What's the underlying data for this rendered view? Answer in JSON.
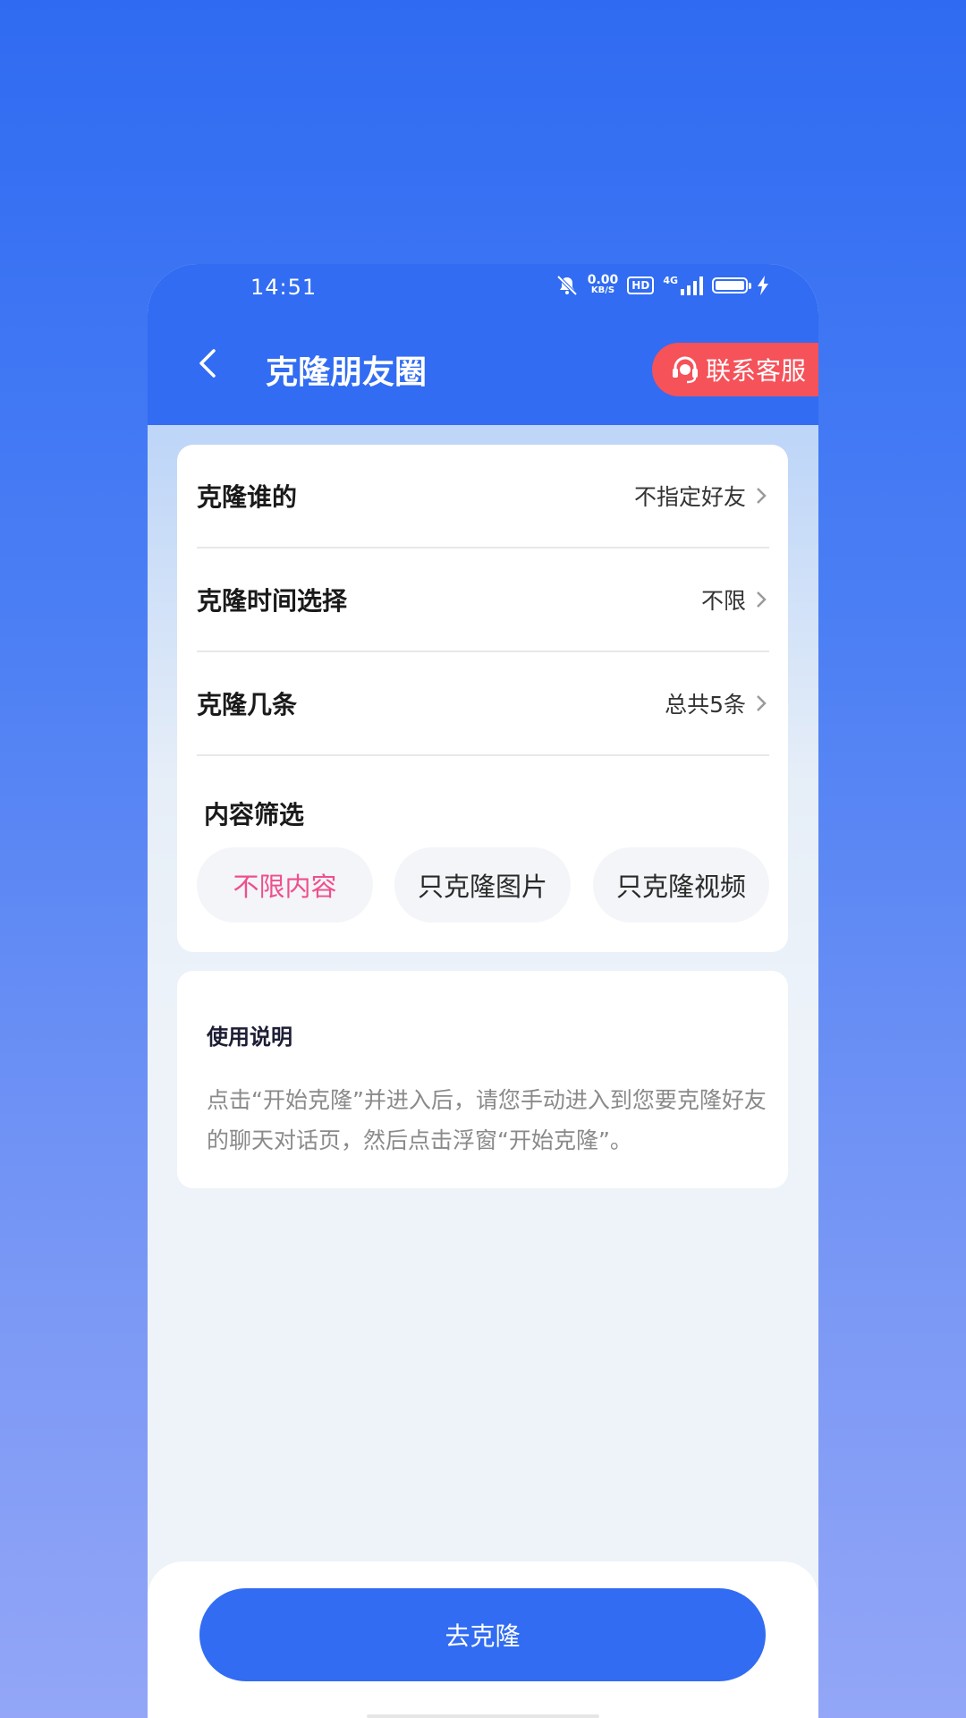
{
  "status_bar": {
    "time": "14:51",
    "net_speed_value": "0.00",
    "net_speed_unit": "KB/S",
    "hd_label": "HD",
    "signal_label": "4G"
  },
  "header": {
    "title": "克隆朋友圈",
    "support_label": "联系客服"
  },
  "settings": {
    "rows": [
      {
        "label": "克隆谁的",
        "value": "不指定好友"
      },
      {
        "label": "克隆时间选择",
        "value": "不限"
      },
      {
        "label": "克隆几条",
        "value": "总共5条"
      }
    ],
    "filter_title": "内容筛选",
    "filter_options": [
      {
        "label": "不限内容",
        "selected": true
      },
      {
        "label": "只克隆图片",
        "selected": false
      },
      {
        "label": "只克隆视频",
        "selected": false
      }
    ]
  },
  "help": {
    "title": "使用说明",
    "text": "点击“开始克隆”并进入后，请您手动进入到您要克隆好友的聊天对话页，然后点击浮窗“开始克隆”。"
  },
  "footer": {
    "go_label": "去克隆"
  },
  "colors": {
    "primary": "#316cf2",
    "support_red": "#f5525a",
    "active_chip_text": "#ef4f8d"
  }
}
